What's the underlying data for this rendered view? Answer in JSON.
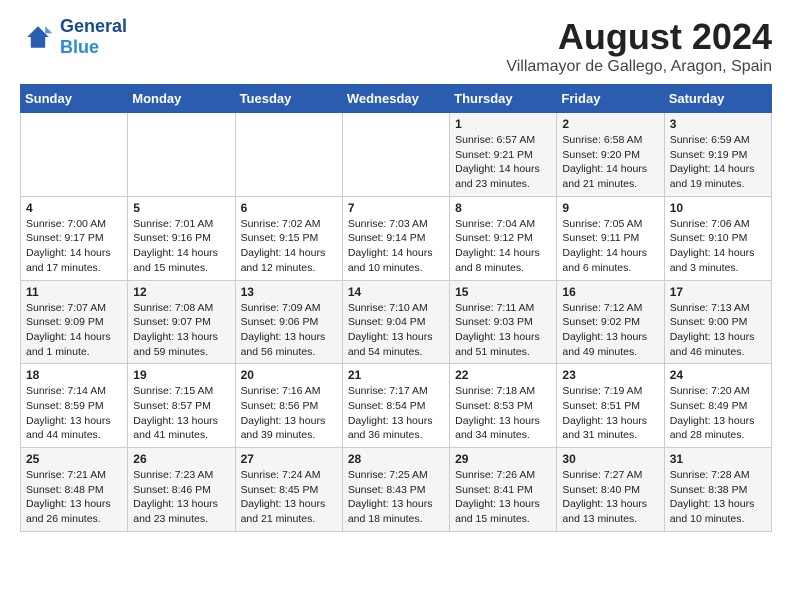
{
  "logo": {
    "line1": "General",
    "line2": "Blue"
  },
  "title": "August 2024",
  "location": "Villamayor de Gallego, Aragon, Spain",
  "weekdays": [
    "Sunday",
    "Monday",
    "Tuesday",
    "Wednesday",
    "Thursday",
    "Friday",
    "Saturday"
  ],
  "weeks": [
    [
      {
        "day": "",
        "info": ""
      },
      {
        "day": "",
        "info": ""
      },
      {
        "day": "",
        "info": ""
      },
      {
        "day": "",
        "info": ""
      },
      {
        "day": "1",
        "info": "Sunrise: 6:57 AM\nSunset: 9:21 PM\nDaylight: 14 hours\nand 23 minutes."
      },
      {
        "day": "2",
        "info": "Sunrise: 6:58 AM\nSunset: 9:20 PM\nDaylight: 14 hours\nand 21 minutes."
      },
      {
        "day": "3",
        "info": "Sunrise: 6:59 AM\nSunset: 9:19 PM\nDaylight: 14 hours\nand 19 minutes."
      }
    ],
    [
      {
        "day": "4",
        "info": "Sunrise: 7:00 AM\nSunset: 9:17 PM\nDaylight: 14 hours\nand 17 minutes."
      },
      {
        "day": "5",
        "info": "Sunrise: 7:01 AM\nSunset: 9:16 PM\nDaylight: 14 hours\nand 15 minutes."
      },
      {
        "day": "6",
        "info": "Sunrise: 7:02 AM\nSunset: 9:15 PM\nDaylight: 14 hours\nand 12 minutes."
      },
      {
        "day": "7",
        "info": "Sunrise: 7:03 AM\nSunset: 9:14 PM\nDaylight: 14 hours\nand 10 minutes."
      },
      {
        "day": "8",
        "info": "Sunrise: 7:04 AM\nSunset: 9:12 PM\nDaylight: 14 hours\nand 8 minutes."
      },
      {
        "day": "9",
        "info": "Sunrise: 7:05 AM\nSunset: 9:11 PM\nDaylight: 14 hours\nand 6 minutes."
      },
      {
        "day": "10",
        "info": "Sunrise: 7:06 AM\nSunset: 9:10 PM\nDaylight: 14 hours\nand 3 minutes."
      }
    ],
    [
      {
        "day": "11",
        "info": "Sunrise: 7:07 AM\nSunset: 9:09 PM\nDaylight: 14 hours\nand 1 minute."
      },
      {
        "day": "12",
        "info": "Sunrise: 7:08 AM\nSunset: 9:07 PM\nDaylight: 13 hours\nand 59 minutes."
      },
      {
        "day": "13",
        "info": "Sunrise: 7:09 AM\nSunset: 9:06 PM\nDaylight: 13 hours\nand 56 minutes."
      },
      {
        "day": "14",
        "info": "Sunrise: 7:10 AM\nSunset: 9:04 PM\nDaylight: 13 hours\nand 54 minutes."
      },
      {
        "day": "15",
        "info": "Sunrise: 7:11 AM\nSunset: 9:03 PM\nDaylight: 13 hours\nand 51 minutes."
      },
      {
        "day": "16",
        "info": "Sunrise: 7:12 AM\nSunset: 9:02 PM\nDaylight: 13 hours\nand 49 minutes."
      },
      {
        "day": "17",
        "info": "Sunrise: 7:13 AM\nSunset: 9:00 PM\nDaylight: 13 hours\nand 46 minutes."
      }
    ],
    [
      {
        "day": "18",
        "info": "Sunrise: 7:14 AM\nSunset: 8:59 PM\nDaylight: 13 hours\nand 44 minutes."
      },
      {
        "day": "19",
        "info": "Sunrise: 7:15 AM\nSunset: 8:57 PM\nDaylight: 13 hours\nand 41 minutes."
      },
      {
        "day": "20",
        "info": "Sunrise: 7:16 AM\nSunset: 8:56 PM\nDaylight: 13 hours\nand 39 minutes."
      },
      {
        "day": "21",
        "info": "Sunrise: 7:17 AM\nSunset: 8:54 PM\nDaylight: 13 hours\nand 36 minutes."
      },
      {
        "day": "22",
        "info": "Sunrise: 7:18 AM\nSunset: 8:53 PM\nDaylight: 13 hours\nand 34 minutes."
      },
      {
        "day": "23",
        "info": "Sunrise: 7:19 AM\nSunset: 8:51 PM\nDaylight: 13 hours\nand 31 minutes."
      },
      {
        "day": "24",
        "info": "Sunrise: 7:20 AM\nSunset: 8:49 PM\nDaylight: 13 hours\nand 28 minutes."
      }
    ],
    [
      {
        "day": "25",
        "info": "Sunrise: 7:21 AM\nSunset: 8:48 PM\nDaylight: 13 hours\nand 26 minutes."
      },
      {
        "day": "26",
        "info": "Sunrise: 7:23 AM\nSunset: 8:46 PM\nDaylight: 13 hours\nand 23 minutes."
      },
      {
        "day": "27",
        "info": "Sunrise: 7:24 AM\nSunset: 8:45 PM\nDaylight: 13 hours\nand 21 minutes."
      },
      {
        "day": "28",
        "info": "Sunrise: 7:25 AM\nSunset: 8:43 PM\nDaylight: 13 hours\nand 18 minutes."
      },
      {
        "day": "29",
        "info": "Sunrise: 7:26 AM\nSunset: 8:41 PM\nDaylight: 13 hours\nand 15 minutes."
      },
      {
        "day": "30",
        "info": "Sunrise: 7:27 AM\nSunset: 8:40 PM\nDaylight: 13 hours\nand 13 minutes."
      },
      {
        "day": "31",
        "info": "Sunrise: 7:28 AM\nSunset: 8:38 PM\nDaylight: 13 hours\nand 10 minutes."
      }
    ]
  ]
}
